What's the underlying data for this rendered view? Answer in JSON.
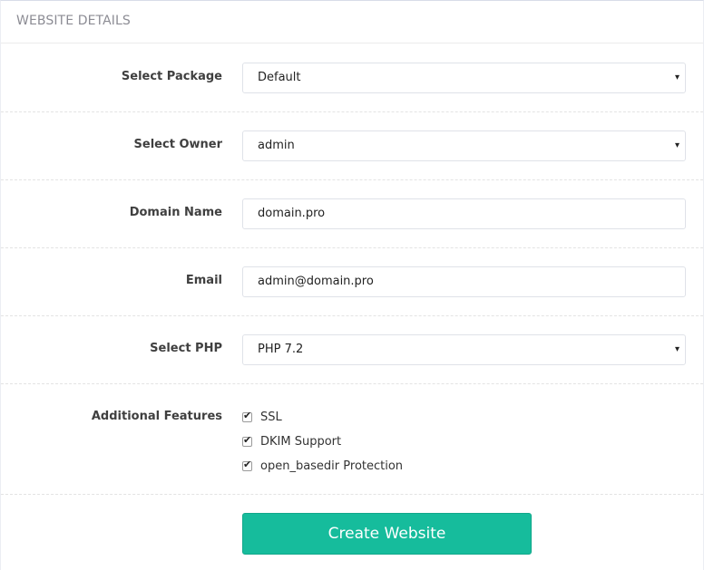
{
  "panel": {
    "title": "WEBSITE DETAILS"
  },
  "form": {
    "package": {
      "label": "Select Package",
      "value": "Default"
    },
    "owner": {
      "label": "Select Owner",
      "value": "admin"
    },
    "domain": {
      "label": "Domain Name",
      "value": "domain.pro"
    },
    "email": {
      "label": "Email",
      "value": "admin@domain.pro"
    },
    "php": {
      "label": "Select PHP",
      "value": "PHP 7.2"
    },
    "features": {
      "label": "Additional Features",
      "options": [
        {
          "label": "SSL",
          "checked": true
        },
        {
          "label": "DKIM Support",
          "checked": true
        },
        {
          "label": "open_basedir Protection",
          "checked": true
        }
      ]
    },
    "submit_label": "Create Website"
  },
  "icons": {
    "caret": "▾",
    "check": "✔"
  }
}
